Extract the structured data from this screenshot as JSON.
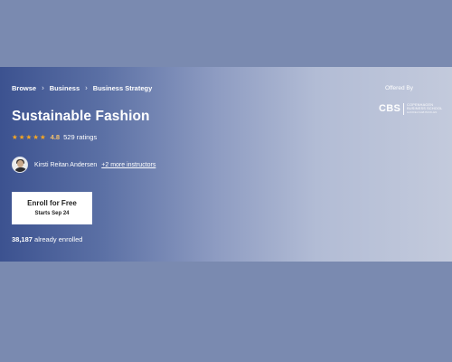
{
  "breadcrumb": {
    "items": [
      {
        "label": "Browse"
      },
      {
        "label": "Business"
      },
      {
        "label": "Business Strategy"
      }
    ],
    "separator_icon": "chevron-right-icon"
  },
  "course": {
    "title": "Sustainable Fashion",
    "rating": {
      "stars": 5,
      "star_icon": "star-icon",
      "star_color": "#f5a623",
      "value": "4.8",
      "count_text": "529 ratings"
    },
    "instructor": {
      "name": "Kirsti Reitan Andersen",
      "more_link": "+2 more instructors"
    },
    "enroll": {
      "label": "Enroll for Free",
      "sublabel": "Starts Sep 24"
    },
    "enrolled": {
      "count": "38,187",
      "suffix": "already enrolled"
    }
  },
  "partner": {
    "offered_by_label": "Offered By",
    "logo_mark": "CBS",
    "logo_line1": "COPENHAGEN",
    "logo_line2": "BUSINESS SCHOOL",
    "logo_line3": "HANDELSHØJSKOLEN"
  },
  "colors": {
    "banner_start": "#3c5290",
    "banner_end": "#c3cadc",
    "page_background": "#7a8ab0",
    "accent_rating": "#f5c26b"
  }
}
